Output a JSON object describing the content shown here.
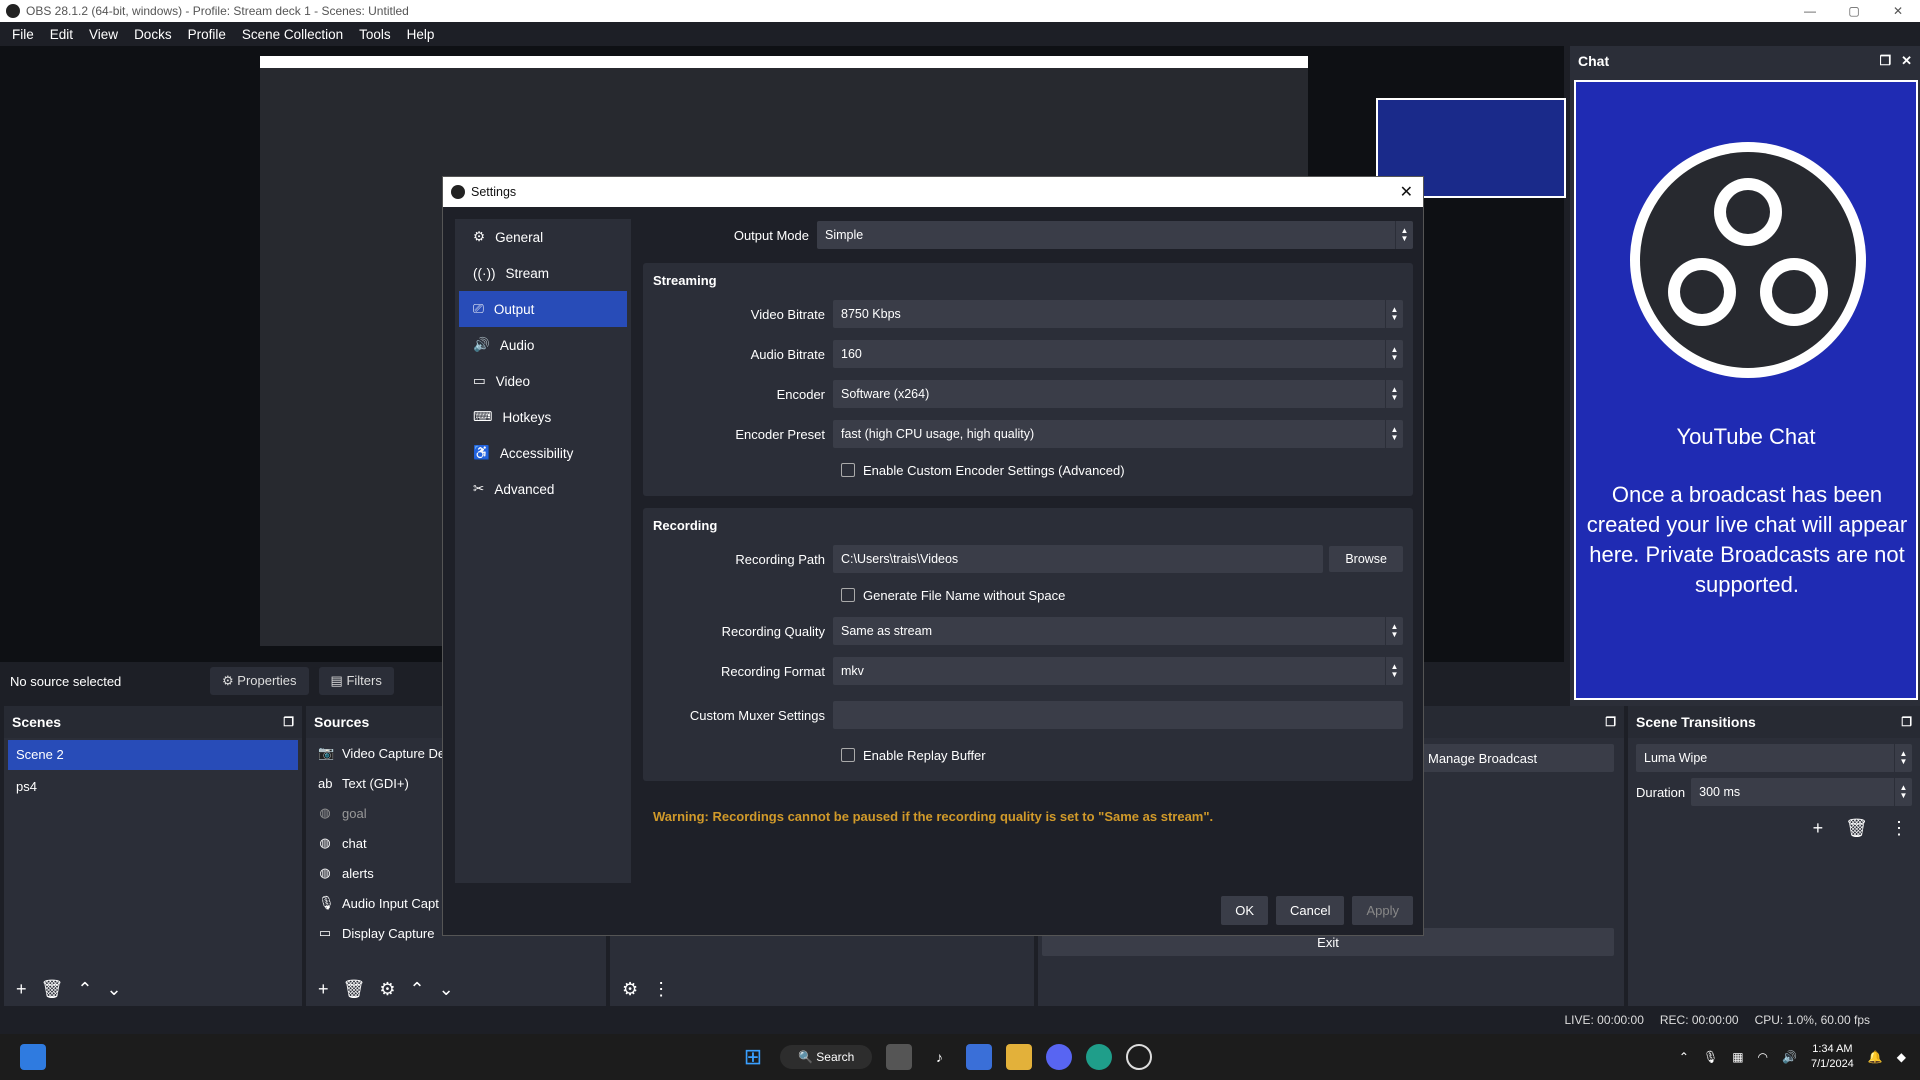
{
  "window": {
    "title": "OBS 28.1.2 (64-bit, windows) - Profile: Stream deck 1 - Scenes: Untitled"
  },
  "menu": [
    "File",
    "Edit",
    "View",
    "Docks",
    "Profile",
    "Scene Collection",
    "Tools",
    "Help"
  ],
  "chat_dock": {
    "title": "Chat",
    "heading": "YouTube Chat",
    "message": "Once a broadcast has been created your live chat will appear here. Private Broadcasts are not supported."
  },
  "context_bar": {
    "no_source": "No source selected",
    "properties": "Properties",
    "filters": "Filters"
  },
  "scenes": {
    "title": "Scenes",
    "items": [
      "Scene 2",
      "ps4"
    ]
  },
  "sources": {
    "title": "Sources",
    "items": [
      {
        "label": "Video Capture De",
        "icon": "camera-icon"
      },
      {
        "label": "Text (GDI+)",
        "icon": "text-icon"
      },
      {
        "label": "goal",
        "icon": "globe-icon"
      },
      {
        "label": "chat",
        "icon": "globe-icon"
      },
      {
        "label": "alerts",
        "icon": "globe-icon"
      },
      {
        "label": "Audio Input Capt",
        "icon": "mic-icon"
      },
      {
        "label": "Display Capture",
        "icon": "monitor-icon"
      }
    ]
  },
  "controls": {
    "manage_broadcast": "Manage Broadcast",
    "exit": "Exit"
  },
  "transitions": {
    "title": "Scene Transitions",
    "type": "Luma Wipe",
    "duration_label": "Duration",
    "duration": "300 ms"
  },
  "status": {
    "live": "LIVE: 00:00:00",
    "rec": "REC: 00:00:00",
    "cpu": "CPU: 1.0%, 60.00 fps"
  },
  "settings": {
    "title": "Settings",
    "nav": [
      "General",
      "Stream",
      "Output",
      "Audio",
      "Video",
      "Hotkeys",
      "Accessibility",
      "Advanced"
    ],
    "output_mode_label": "Output Mode",
    "output_mode": "Simple",
    "streaming": {
      "title": "Streaming",
      "video_bitrate_label": "Video Bitrate",
      "video_bitrate": "8750 Kbps",
      "audio_bitrate_label": "Audio Bitrate",
      "audio_bitrate": "160",
      "encoder_label": "Encoder",
      "encoder": "Software (x264)",
      "preset_label": "Encoder Preset",
      "preset": "fast (high CPU usage, high quality)",
      "custom_encoder": "Enable Custom Encoder Settings (Advanced)"
    },
    "recording": {
      "title": "Recording",
      "path_label": "Recording Path",
      "path": "C:\\Users\\trais\\Videos",
      "browse": "Browse",
      "no_space": "Generate File Name without Space",
      "quality_label": "Recording Quality",
      "quality": "Same as stream",
      "format_label": "Recording Format",
      "format": "mkv",
      "muxer_label": "Custom Muxer Settings",
      "muxer": "",
      "replay": "Enable Replay Buffer"
    },
    "warning": "Warning: Recordings cannot be paused if the recording quality is set to \"Same as stream\".",
    "ok": "OK",
    "cancel": "Cancel",
    "apply": "Apply"
  },
  "taskbar": {
    "search": "Search",
    "time": "1:34 AM",
    "date": "7/1/2024"
  }
}
